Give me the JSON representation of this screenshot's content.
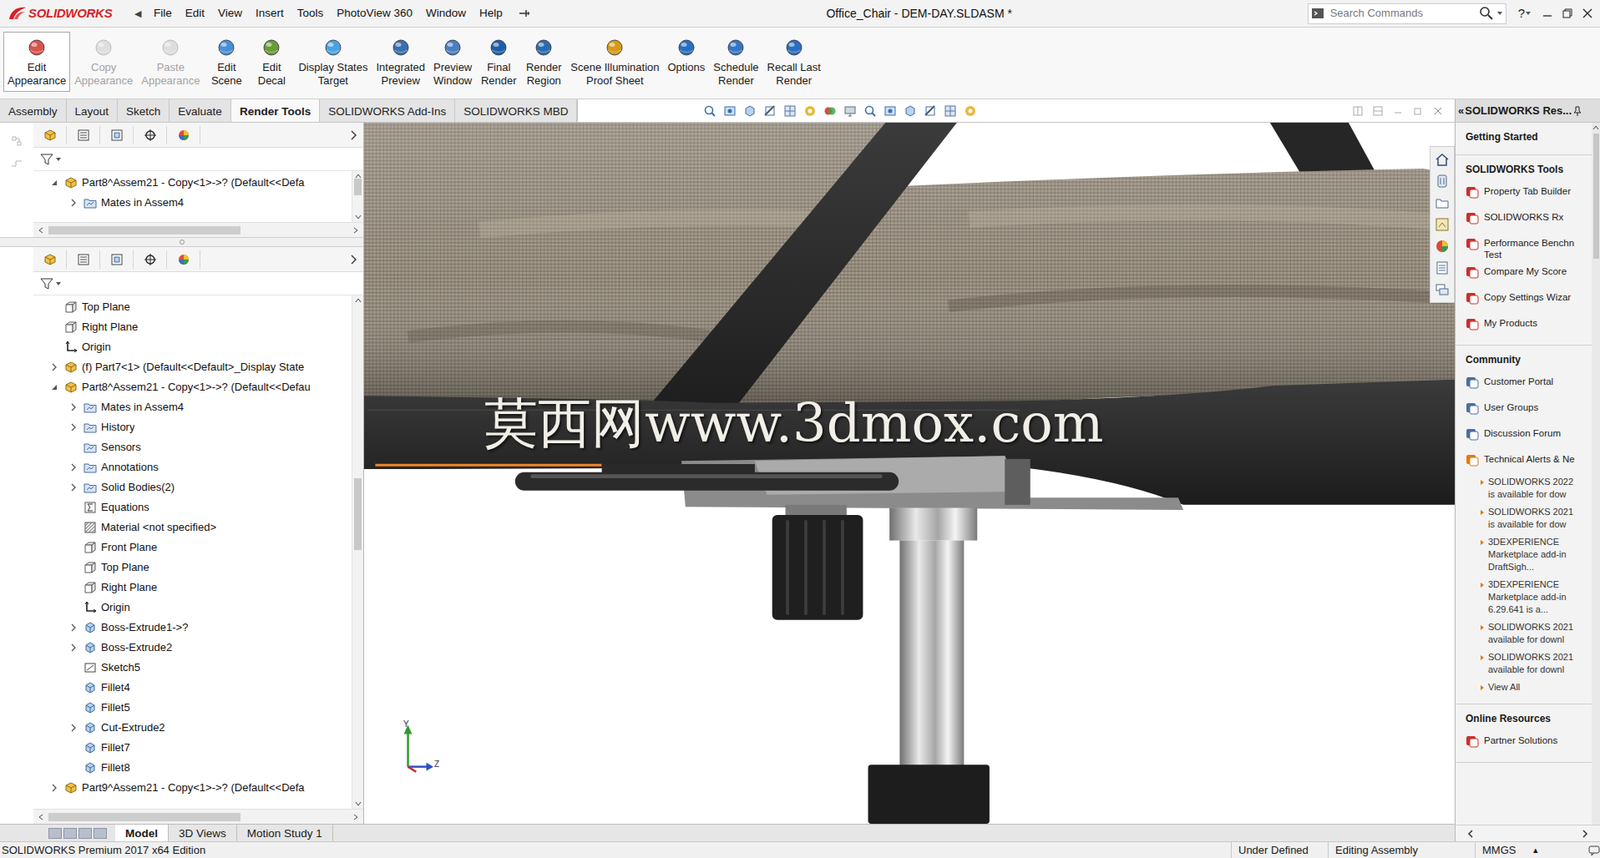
{
  "window": {
    "title": "Office_Chair - DEM-DAY.SLDASM *"
  },
  "logo": {
    "text": "SOLIDWORKS"
  },
  "menu_arrow": "◀",
  "menus": [
    "File",
    "Edit",
    "View",
    "Insert",
    "Tools",
    "PhotoView 360",
    "Window",
    "Help"
  ],
  "search": {
    "placeholder": "Search Commands"
  },
  "help": {
    "label": "?"
  },
  "ribbon": [
    {
      "lines": [
        "Edit",
        "Appearance"
      ],
      "selected": true,
      "disabled": false
    },
    {
      "lines": [
        "Copy",
        "Appearance"
      ],
      "selected": false,
      "disabled": true
    },
    {
      "lines": [
        "Paste",
        "Appearance"
      ],
      "selected": false,
      "disabled": true
    },
    {
      "lines": [
        "Edit",
        "Scene"
      ],
      "selected": false,
      "disabled": false
    },
    {
      "lines": [
        "Edit",
        "Decal"
      ],
      "selected": false,
      "disabled": false
    },
    {
      "lines": [
        "Display States",
        "Target"
      ],
      "selected": false,
      "disabled": false
    },
    {
      "lines": [
        "Integrated",
        "Preview"
      ],
      "selected": false,
      "disabled": false
    },
    {
      "lines": [
        "Preview",
        "Window"
      ],
      "selected": false,
      "disabled": false
    },
    {
      "lines": [
        "Final",
        "Render"
      ],
      "selected": false,
      "disabled": false
    },
    {
      "lines": [
        "Render",
        "Region"
      ],
      "selected": false,
      "disabled": false
    },
    {
      "lines": [
        "Scene Illumination",
        "Proof Sheet"
      ],
      "selected": false,
      "disabled": false
    },
    {
      "lines": [
        "Options"
      ],
      "selected": false,
      "disabled": false
    },
    {
      "lines": [
        "Schedule",
        "Render"
      ],
      "selected": false,
      "disabled": false
    },
    {
      "lines": [
        "Recall Last",
        "Render"
      ],
      "selected": false,
      "disabled": false
    }
  ],
  "tabs": [
    {
      "label": "Assembly",
      "selected": false
    },
    {
      "label": "Layout",
      "selected": false
    },
    {
      "label": "Sketch",
      "selected": false
    },
    {
      "label": "Evaluate",
      "selected": false
    },
    {
      "label": "Render Tools",
      "selected": true
    },
    {
      "label": "SOLIDWORKS Add-Ins",
      "selected": false
    },
    {
      "label": "SOLIDWORKS MBD",
      "selected": false
    }
  ],
  "tree_top": [
    {
      "label": "Part8^Assem21 - Copy<1>->? (Default<<Defa",
      "level": 0,
      "kind": "component",
      "expandable": true,
      "expanded": true
    },
    {
      "label": "Mates in Assem4",
      "level": 1,
      "kind": "folder",
      "expandable": true,
      "expanded": false
    }
  ],
  "tree_main": [
    {
      "label": "Top Plane",
      "level": 0,
      "kind": "plane",
      "expandable": false,
      "expanded": false
    },
    {
      "label": "Right Plane",
      "level": 0,
      "kind": "plane",
      "expandable": false,
      "expanded": false
    },
    {
      "label": "Origin",
      "level": 0,
      "kind": "origin",
      "expandable": false,
      "expanded": false
    },
    {
      "label": "(f) Part7<1> (Default<<Default>_Display State",
      "level": 0,
      "kind": "component",
      "expandable": true,
      "expanded": false
    },
    {
      "label": "Part8^Assem21 - Copy<1>->? (Default<<Defau",
      "level": 0,
      "kind": "component",
      "expandable": true,
      "expanded": true
    },
    {
      "label": "Mates in Assem4",
      "level": 1,
      "kind": "folder",
      "expandable": true,
      "expanded": false
    },
    {
      "label": "History",
      "level": 1,
      "kind": "folder",
      "expandable": true,
      "expanded": false
    },
    {
      "label": "Sensors",
      "level": 1,
      "kind": "folder",
      "expandable": false,
      "expanded": false
    },
    {
      "label": "Annotations",
      "level": 1,
      "kind": "folder",
      "expandable": true,
      "expanded": false
    },
    {
      "label": "Solid Bodies(2)",
      "level": 1,
      "kind": "folder",
      "expandable": true,
      "expanded": false
    },
    {
      "label": "Equations",
      "level": 1,
      "kind": "equations",
      "expandable": false,
      "expanded": false
    },
    {
      "label": "Material <not specified>",
      "level": 1,
      "kind": "material",
      "expandable": false,
      "expanded": false
    },
    {
      "label": "Front Plane",
      "level": 1,
      "kind": "plane",
      "expandable": false,
      "expanded": false
    },
    {
      "label": "Top Plane",
      "level": 1,
      "kind": "plane",
      "expandable": false,
      "expanded": false
    },
    {
      "label": "Right Plane",
      "level": 1,
      "kind": "plane",
      "expandable": false,
      "expanded": false
    },
    {
      "label": "Origin",
      "level": 1,
      "kind": "origin",
      "expandable": false,
      "expanded": false
    },
    {
      "label": "Boss-Extrude1->?",
      "level": 1,
      "kind": "feature",
      "expandable": true,
      "expanded": false
    },
    {
      "label": "Boss-Extrude2",
      "level": 1,
      "kind": "feature",
      "expandable": true,
      "expanded": false
    },
    {
      "label": "Sketch5",
      "level": 1,
      "kind": "sketch",
      "expandable": false,
      "expanded": false
    },
    {
      "label": "Fillet4",
      "level": 1,
      "kind": "feature",
      "expandable": false,
      "expanded": false
    },
    {
      "label": "Fillet5",
      "level": 1,
      "kind": "feature",
      "expandable": false,
      "expanded": false
    },
    {
      "label": "Cut-Extrude2",
      "level": 1,
      "kind": "feature",
      "expandable": true,
      "expanded": false
    },
    {
      "label": "Fillet7",
      "level": 1,
      "kind": "feature",
      "expandable": false,
      "expanded": false
    },
    {
      "label": "Fillet8",
      "level": 1,
      "kind": "feature",
      "expandable": false,
      "expanded": false
    },
    {
      "label": "Part9^Assem21 - Copy<1>->? (Default<<Defa",
      "level": 0,
      "kind": "component",
      "expandable": true,
      "expanded": false
    }
  ],
  "viewport": {
    "watermark": "莫西网www.3dmox.com",
    "axis_labels": [
      "Y",
      "Z"
    ]
  },
  "task_pane": {
    "collapse": "«",
    "title": "SOLIDWORKS Res...",
    "sections": [
      {
        "heading": "Getting Started"
      },
      {
        "heading": "SOLIDWORKS Tools",
        "items": [
          {
            "lines": [
              "Property Tab Builder"
            ]
          },
          {
            "lines": [
              "SOLIDWORKS Rx"
            ]
          },
          {
            "lines": [
              "Performance Benchn",
              "Test"
            ]
          },
          {
            "lines": [
              "Compare My Score"
            ]
          },
          {
            "lines": [
              "Copy Settings Wizar"
            ]
          },
          {
            "lines": [
              "My Products"
            ]
          }
        ]
      },
      {
        "heading": "Community",
        "items": [
          {
            "lines": [
              "Customer Portal"
            ]
          },
          {
            "lines": [
              "User Groups"
            ]
          },
          {
            "lines": [
              "Discussion Forum"
            ]
          },
          {
            "lines": [
              "Technical Alerts & Ne"
            ]
          }
        ],
        "news": [
          {
            "lines": [
              "SOLIDWORKS 2022",
              "is available for dow"
            ]
          },
          {
            "lines": [
              "SOLIDWORKS 2021",
              "is available for dow"
            ]
          },
          {
            "lines": [
              "3DEXPERIENCE",
              "Marketplace add-in",
              "DraftSigh..."
            ]
          },
          {
            "lines": [
              "3DEXPERIENCE",
              "Marketplace add-in",
              "6.29.641 is a..."
            ]
          },
          {
            "lines": [
              "SOLIDWORKS 2021",
              "available for downl"
            ]
          },
          {
            "lines": [
              "SOLIDWORKS 2021",
              "available for downl"
            ]
          }
        ],
        "more": "View All"
      },
      {
        "heading": "Online Resources",
        "items": [
          {
            "lines": [
              "Partner Solutions"
            ]
          }
        ]
      }
    ]
  },
  "bottom_tabs": [
    {
      "label": "Model",
      "selected": true
    },
    {
      "label": "3D Views",
      "selected": false
    },
    {
      "label": "Motion Study 1",
      "selected": false
    }
  ],
  "status": {
    "edition": "SOLIDWORKS Premium 2017 x64 Edition",
    "fields": [
      "Under Defined",
      "Editing Assembly",
      "MMGS"
    ],
    "arrow": "▴"
  }
}
